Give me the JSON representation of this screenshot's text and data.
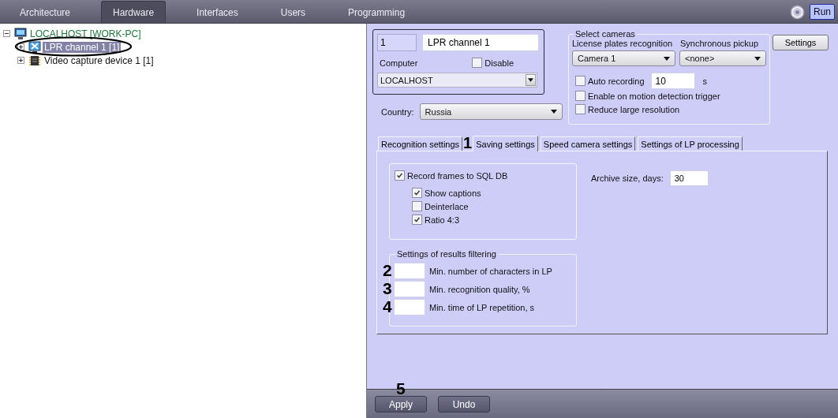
{
  "top_tabs": [
    {
      "label": "Architecture",
      "selected": false
    },
    {
      "label": "Hardware",
      "selected": true
    },
    {
      "label": "Interfaces",
      "selected": false
    },
    {
      "label": "Users",
      "selected": false
    },
    {
      "label": "Programming",
      "selected": false
    }
  ],
  "run_button": "Run",
  "tree": [
    {
      "label": "LOCALHOST [WORK-PC]",
      "kind": "computer",
      "expanded": true,
      "selected": false,
      "circled": false,
      "children": [
        {
          "label": "LPR channel 1 [1]",
          "kind": "lpr",
          "expanded": false,
          "selected": true,
          "circled": true
        },
        {
          "label": "Video capture device 1 [1]",
          "kind": "capture",
          "expanded": false,
          "selected": false,
          "circled": false
        }
      ]
    }
  ],
  "object": {
    "id": "1",
    "name": "LPR channel 1",
    "computer_label": "Computer",
    "disable": {
      "label": "Disable",
      "checked": false
    },
    "computer": "LOCALHOST"
  },
  "country": {
    "label": "Country:",
    "value": "Russia"
  },
  "select_cameras": {
    "title": "Select cameras",
    "recognition_label": "License plates recognition",
    "recognition_camera": "Camera 1",
    "pickup_label": "Synchronous pickup",
    "pickup_camera": "<none>",
    "auto_recording": {
      "label": "Auto recording",
      "checked": false,
      "value": "10",
      "unit": "s"
    },
    "options": [
      {
        "label": "Enable on motion detection trigger",
        "checked": false
      },
      {
        "label": "Reduce large resolution",
        "checked": false
      }
    ]
  },
  "settings_button": "Settings",
  "tabs": [
    {
      "label": "Recognition settings",
      "selected": false
    },
    {
      "label": "Saving settings",
      "selected": true,
      "callout": "1"
    },
    {
      "label": "Speed camera settings",
      "selected": false
    },
    {
      "label": "Settings of LP processing",
      "selected": false
    }
  ],
  "saving": {
    "record": {
      "label": "Record frames to SQL DB",
      "checked": true
    },
    "record_options": [
      {
        "label": "Show captions",
        "checked": true
      },
      {
        "label": "Deinterlace",
        "checked": false
      },
      {
        "label": "Ratio 4:3",
        "checked": true
      }
    ],
    "archive_label": "Archive size, days:",
    "archive_value": "30"
  },
  "filtering": {
    "title": "Settings of results filtering",
    "fields": [
      {
        "label": "Min. number of characters in LP",
        "callout": "2"
      },
      {
        "label": "Min. recognition quality, %",
        "callout": "3"
      },
      {
        "label": "Min. time of LP repetition, s",
        "callout": "4"
      }
    ]
  },
  "buttons": [
    {
      "label": "Apply",
      "callout": "5"
    },
    {
      "label": "Undo"
    }
  ]
}
